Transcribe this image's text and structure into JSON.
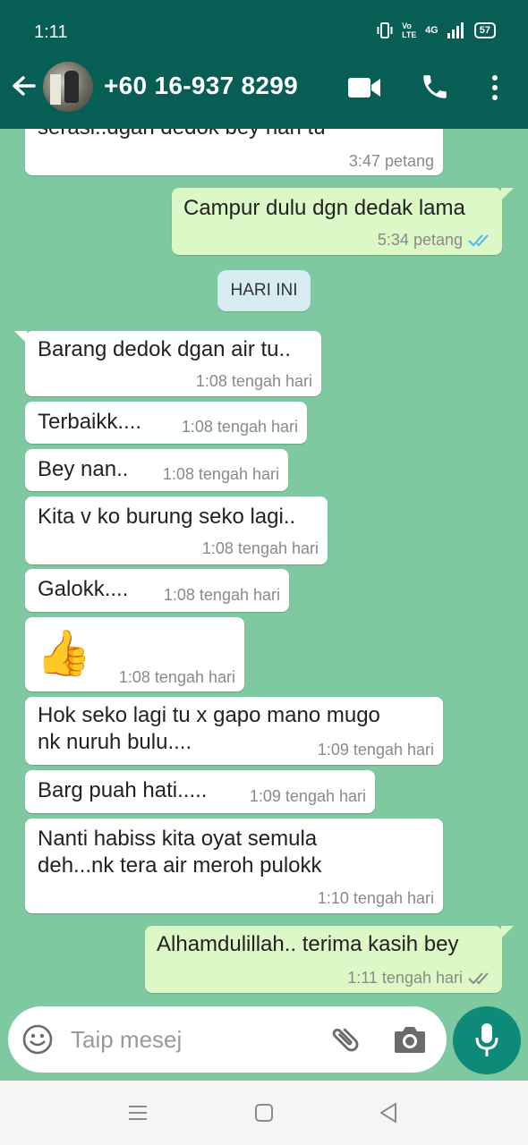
{
  "status_bar": {
    "time": "1:11",
    "network": "4G",
    "volte": "Vo LTE",
    "battery": "57"
  },
  "header": {
    "title": "+60 16-937 8299",
    "back_icon": "arrow-left-icon",
    "video_icon": "video-call-icon",
    "call_icon": "phone-icon",
    "menu_icon": "more-vert-icon"
  },
  "messages": [
    {
      "id": "m0",
      "dir": "in",
      "lines": [
        "serasi..dgan dedok bey hari tu"
      ],
      "time": "3:47 petang"
    },
    {
      "id": "m1",
      "dir": "out",
      "lines": [
        "Campur dulu dgn dedak lama"
      ],
      "time": "5:34 petang",
      "ticks": "read"
    },
    {
      "id": "m2",
      "dir": "in",
      "lines": [
        "Barang dedok dgan air tu.."
      ],
      "time": "1:08 tengah hari"
    },
    {
      "id": "m3",
      "dir": "in",
      "lines": [
        "Terbaikk...."
      ],
      "time": "1:08 tengah hari"
    },
    {
      "id": "m4",
      "dir": "in",
      "lines": [
        "Bey nan.."
      ],
      "time": "1:08 tengah hari"
    },
    {
      "id": "m5",
      "dir": "in",
      "lines": [
        "Kita v ko burung seko lagi.."
      ],
      "time": "1:08 tengah hari"
    },
    {
      "id": "m6",
      "dir": "in",
      "lines": [
        "Galokk...."
      ],
      "time": "1:08 tengah hari"
    },
    {
      "id": "m7",
      "dir": "in",
      "emoji": "👍",
      "time": "1:08 tengah hari"
    },
    {
      "id": "m8",
      "dir": "in",
      "lines": [
        "Hok seko lagi tu x gapo mano mugo",
        "nk nuruh bulu...."
      ],
      "time": "1:09 tengah hari"
    },
    {
      "id": "m9",
      "dir": "in",
      "lines": [
        "Barg puah hati....."
      ],
      "time": "1:09 tengah hari"
    },
    {
      "id": "m10",
      "dir": "in",
      "lines": [
        "Nanti habiss kita oyat semula",
        "deh...nk tera air meroh pulokk"
      ],
      "time": "1:10 tengah hari"
    },
    {
      "id": "m11",
      "dir": "out",
      "lines": [
        "Alhamdulillah.. terima kasih bey"
      ],
      "time": "1:11 tengah hari",
      "ticks": "delivered"
    }
  ],
  "day_chip": "HARI INI",
  "composer": {
    "placeholder": "Taip mesej",
    "emoji_icon": "emoji-icon",
    "attach_icon": "paperclip-icon",
    "camera_icon": "camera-icon",
    "send_icon": "mic-icon"
  },
  "colors": {
    "header": "#075e54",
    "wallpaper": "#7fc9a1",
    "outgoing": "#dcf8c6",
    "incoming": "#ffffff",
    "read_tick": "#4fb3f6",
    "mic": "#0d8a78"
  }
}
